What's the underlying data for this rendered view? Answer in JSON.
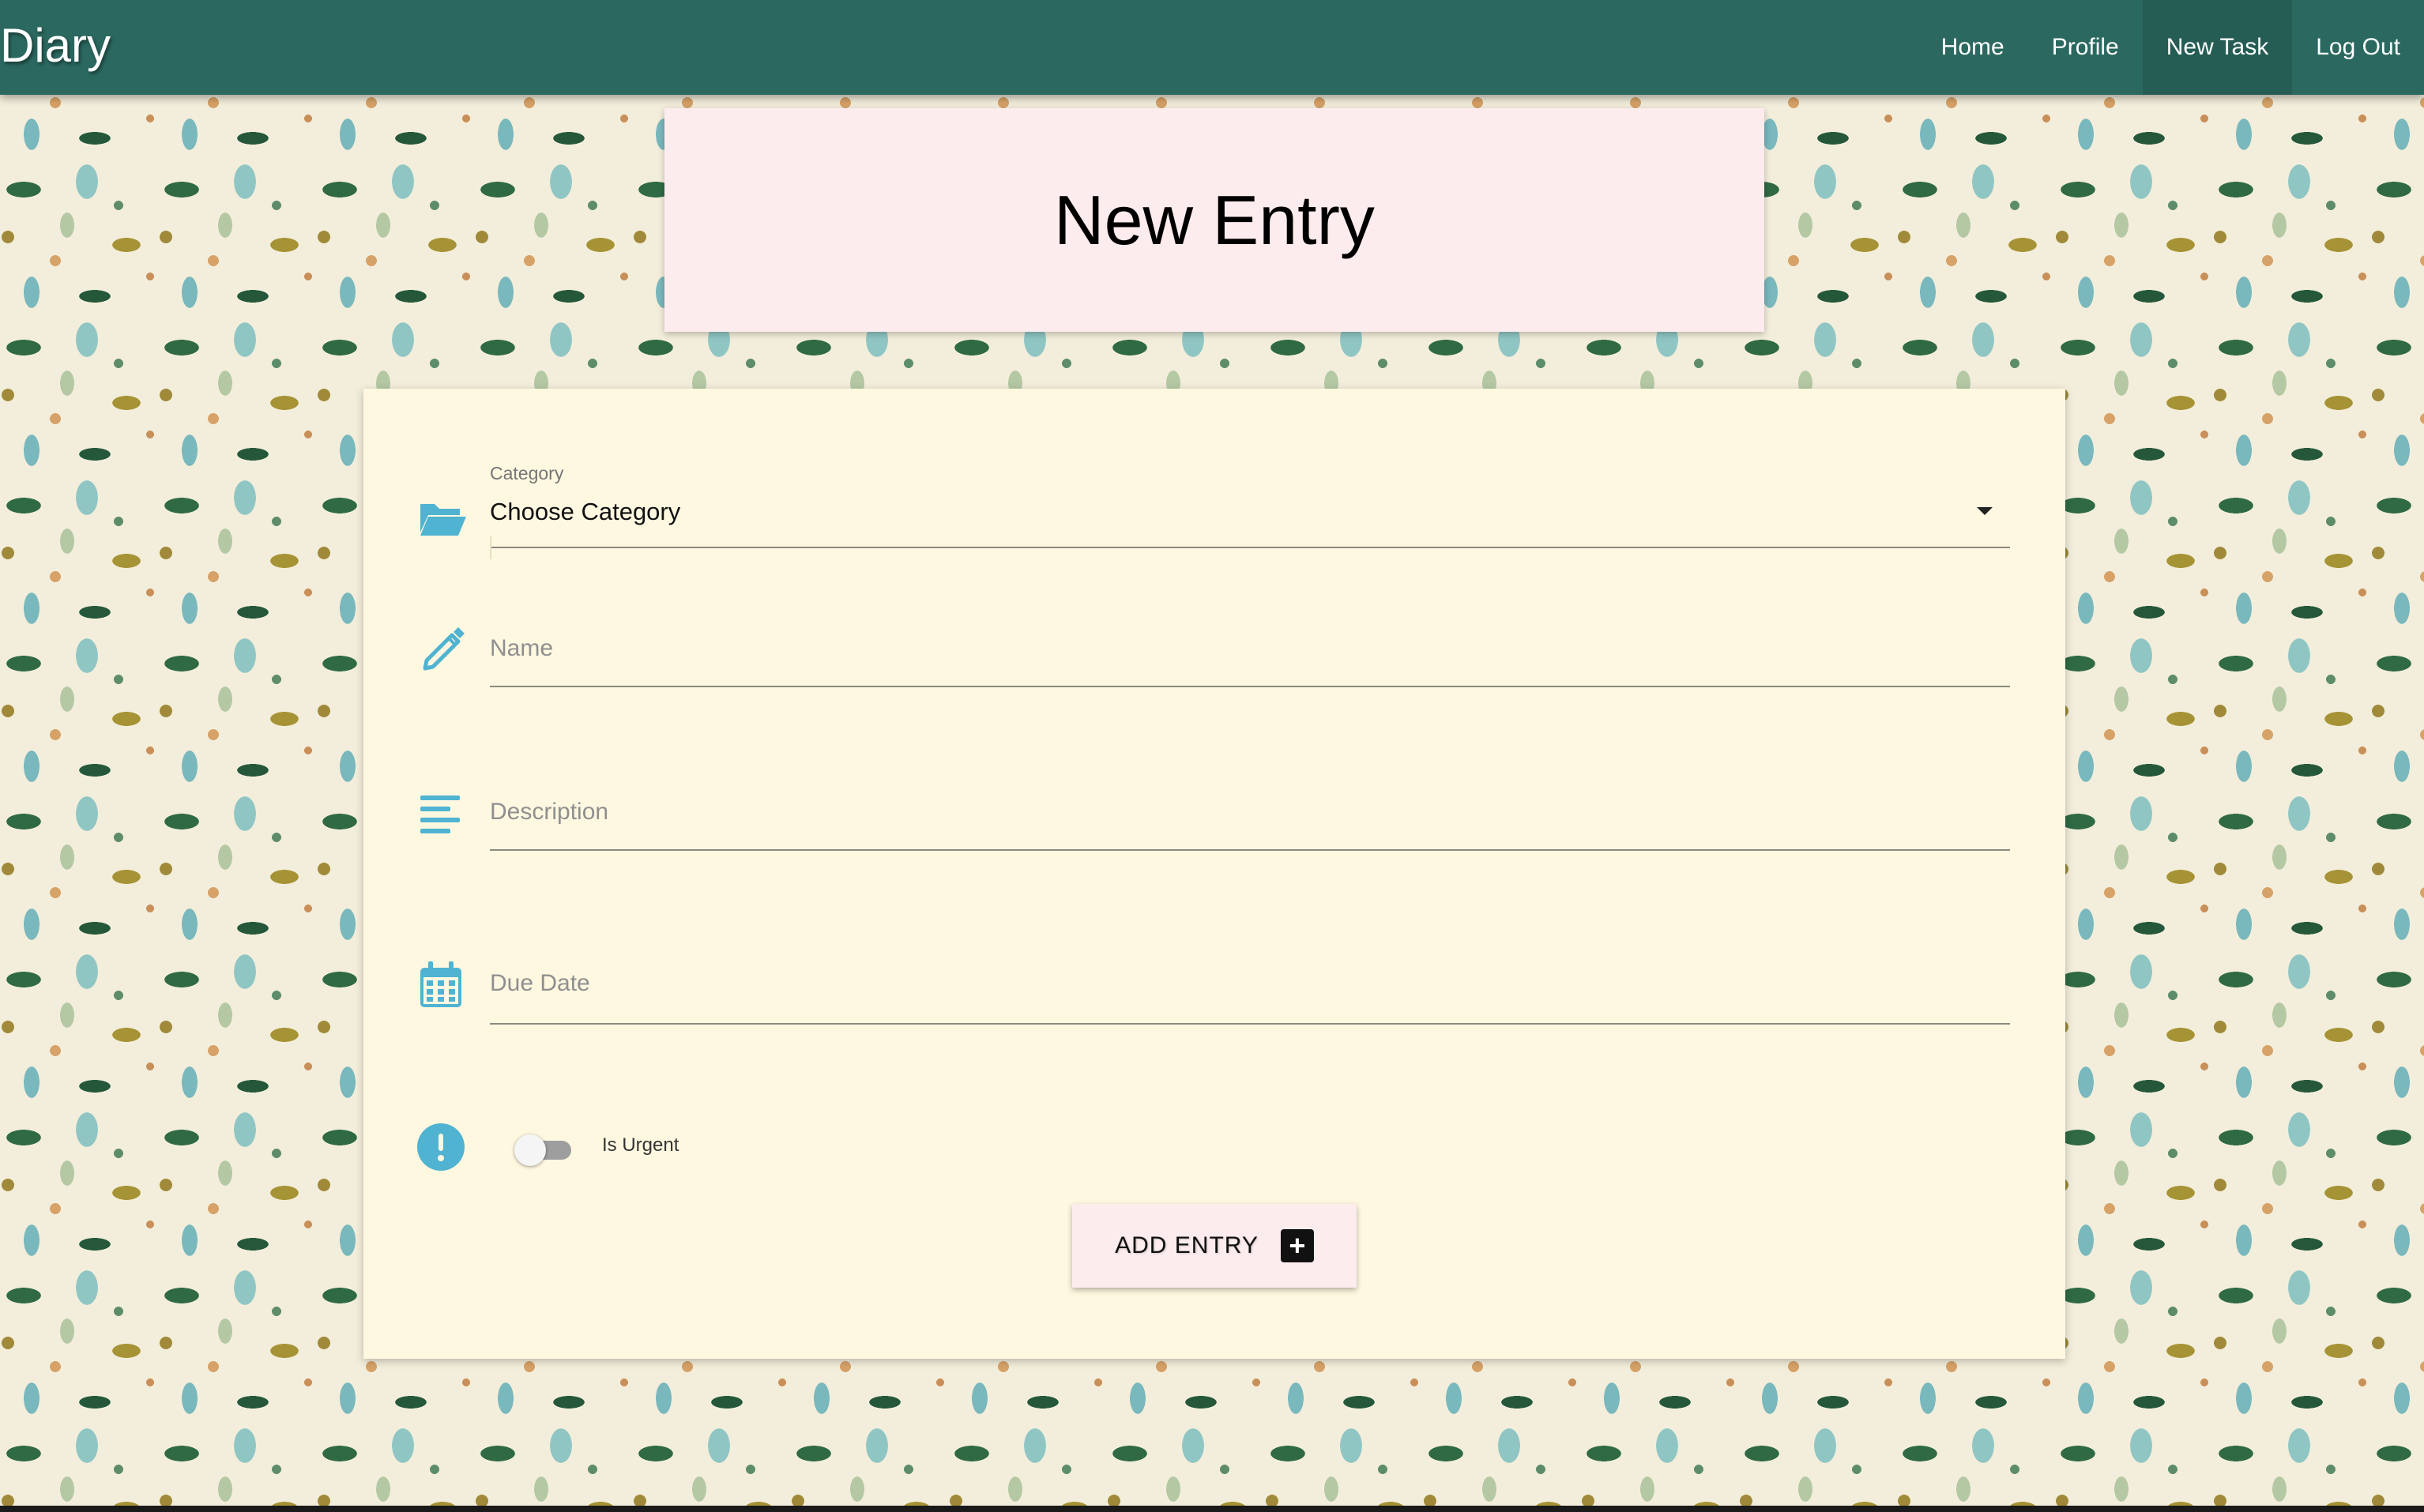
{
  "navbar": {
    "brand": "Diary",
    "links": [
      {
        "label": "Home"
      },
      {
        "label": "Profile"
      },
      {
        "label": "New Task",
        "active": true
      },
      {
        "label": "Log Out"
      }
    ]
  },
  "header": {
    "title": "New Entry"
  },
  "form": {
    "category": {
      "label": "Category",
      "value": "Choose Category",
      "icon": "folder-open-icon"
    },
    "name": {
      "placeholder": "Name",
      "icon": "pencil-icon"
    },
    "description": {
      "placeholder": "Description",
      "icon": "align-left-icon"
    },
    "due_date": {
      "placeholder": "Due Date",
      "icon": "calendar-icon"
    },
    "urgent": {
      "label": "Is Urgent",
      "checked": false,
      "icon": "exclamation-circle-icon"
    },
    "submit": {
      "label": "ADD ENTRY",
      "icon_text": "+"
    }
  },
  "colors": {
    "navbar": "#2b6960",
    "accent_icon": "#4fb3d1",
    "header_card": "#fdecee",
    "form_card": "#fff8e1"
  }
}
